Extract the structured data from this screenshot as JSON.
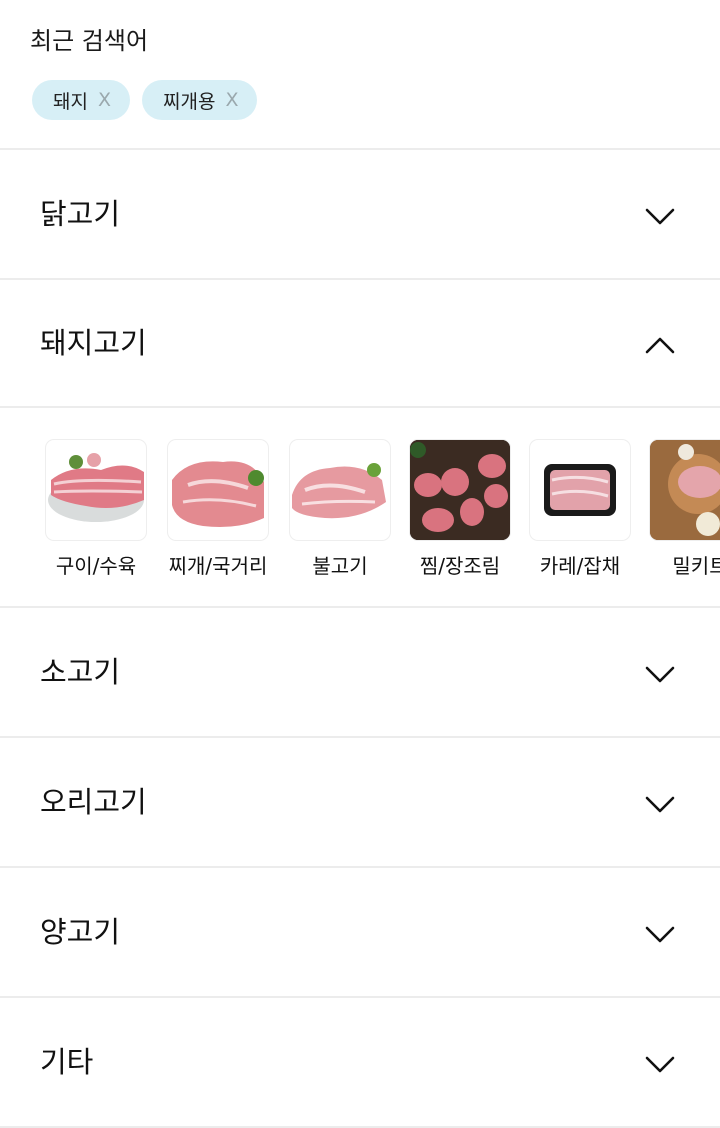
{
  "recent_search": {
    "title": "최근 검색어",
    "chips": [
      {
        "label": "돼지",
        "remove": "X"
      },
      {
        "label": "찌개용",
        "remove": "X"
      }
    ]
  },
  "categories": [
    {
      "label": "닭고기",
      "state": "collapsed",
      "icon": "chevron-down-icon"
    },
    {
      "label": "돼지고기",
      "state": "expanded",
      "icon": "chevron-up-icon"
    },
    {
      "label": "소고기",
      "state": "collapsed",
      "icon": "chevron-down-icon"
    },
    {
      "label": "오리고기",
      "state": "collapsed",
      "icon": "chevron-down-icon"
    },
    {
      "label": "양고기",
      "state": "collapsed",
      "icon": "chevron-down-icon"
    },
    {
      "label": "기타",
      "state": "collapsed",
      "icon": "chevron-down-icon"
    }
  ],
  "pork_subcategories": [
    {
      "label": "구이/수육"
    },
    {
      "label": "찌개/국거리"
    },
    {
      "label": "불고기"
    },
    {
      "label": "찜/장조림"
    },
    {
      "label": "카레/잡채"
    },
    {
      "label": "밀키트"
    }
  ],
  "colors": {
    "chip_bg": "#d7eff6",
    "divider": "#ececec",
    "text": "#111111"
  }
}
